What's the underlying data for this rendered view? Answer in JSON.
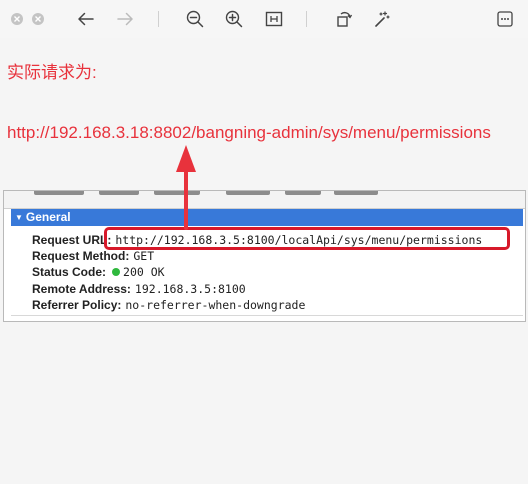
{
  "toolbar": {
    "window_buttons": [
      "close-icon",
      "minimize-icon"
    ],
    "icons": [
      "back-arrow-icon",
      "forward-arrow-icon",
      "zoom-out-icon",
      "zoom-in-icon",
      "fit-icon",
      "rotate-icon",
      "magic-wand-icon",
      "more-icon"
    ]
  },
  "annotation": {
    "title": "实际请求为:",
    "url": "http://192.168.3.18:8802/bangning-admin/sys/menu/permissions",
    "color": "#e8323c"
  },
  "devtools": {
    "section_title": "General",
    "rows": [
      {
        "key": "Request URL:",
        "value": "http://192.168.3.5:8100/localApi/sys/menu/permissions"
      },
      {
        "key": "Request Method:",
        "value": "GET"
      },
      {
        "key": "Status Code:",
        "value": "200 OK"
      },
      {
        "key": "Remote Address:",
        "value": "192.168.3.5:8100"
      },
      {
        "key": "Referrer Policy:",
        "value": "no-referrer-when-downgrade"
      }
    ],
    "header_color": "#3879d9",
    "status_color": "#2fb83d"
  },
  "highlight_color": "#d7192a"
}
